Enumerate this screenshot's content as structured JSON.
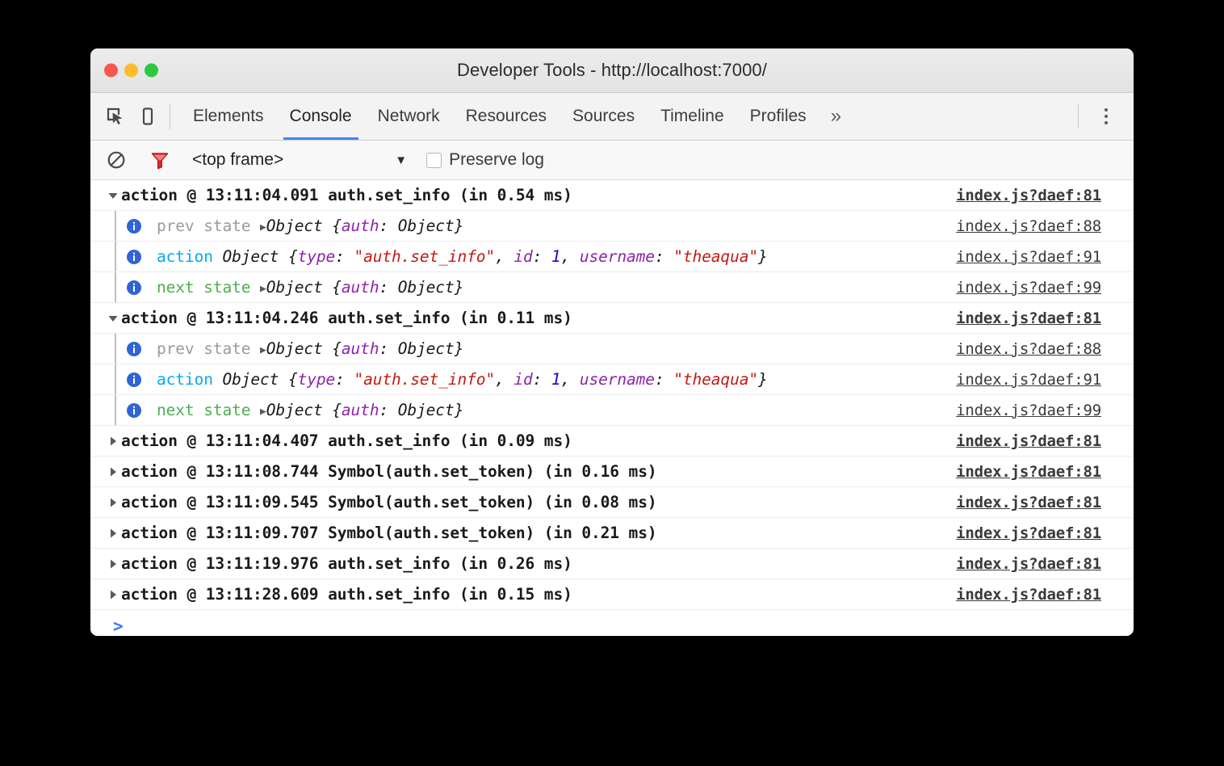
{
  "window": {
    "title": "Developer Tools - http://localhost:7000/",
    "traffic_lights": [
      {
        "name": "close",
        "color": "#f9564f"
      },
      {
        "name": "minimize",
        "color": "#fcbc2d"
      },
      {
        "name": "zoom",
        "color": "#2ec840"
      }
    ]
  },
  "tabbar": {
    "inspect_icon": "inspect-element-icon",
    "device_icon": "device-toolbar-icon",
    "tabs": [
      {
        "label": "Elements",
        "active": false
      },
      {
        "label": "Console",
        "active": true
      },
      {
        "label": "Network",
        "active": false
      },
      {
        "label": "Resources",
        "active": false
      },
      {
        "label": "Sources",
        "active": false
      },
      {
        "label": "Timeline",
        "active": false
      },
      {
        "label": "Profiles",
        "active": false
      }
    ],
    "more_label": "»",
    "menu_icon": "kebab-menu-icon",
    "active_underline_color": "#4285f4"
  },
  "filterbar": {
    "clear_icon": "clear-console-icon",
    "filter_icon": "filter-icon",
    "filter_active_color": "#d81f1f",
    "frame_selector": "<top frame>",
    "caret": "▼",
    "preserve_log_label": "Preserve log",
    "preserve_log_checked": false
  },
  "console": {
    "rows": [
      {
        "kind": "header",
        "expanded": true,
        "text": "action @ 13:11:04.091 auth.set_info (in 0.54 ms)",
        "source": "index.js?daef:81"
      },
      {
        "kind": "prev-state",
        "label": "prev state",
        "text": "Object {auth: Object}",
        "source": "index.js?daef:88"
      },
      {
        "kind": "action",
        "label": "action",
        "text": "Object {type: \"auth.set_info\", id: 1, username: \"theaqua\"}",
        "source": "index.js?daef:91"
      },
      {
        "kind": "next-state",
        "label": "next state",
        "text": "Object {auth: Object}",
        "source": "index.js?daef:99"
      },
      {
        "kind": "header",
        "expanded": true,
        "text": "action @ 13:11:04.246 auth.set_info (in 0.11 ms)",
        "source": "index.js?daef:81"
      },
      {
        "kind": "prev-state",
        "label": "prev state",
        "text": "Object {auth: Object}",
        "source": "index.js?daef:88"
      },
      {
        "kind": "action",
        "label": "action",
        "text": "Object {type: \"auth.set_info\", id: 1, username: \"theaqua\"}",
        "source": "index.js?daef:91"
      },
      {
        "kind": "next-state",
        "label": "next state",
        "text": "Object {auth: Object}",
        "source": "index.js?daef:99"
      },
      {
        "kind": "collapsed",
        "expanded": false,
        "text": "action @ 13:11:04.407 auth.set_info (in 0.09 ms)",
        "source": "index.js?daef:81"
      },
      {
        "kind": "collapsed",
        "expanded": false,
        "text": "action @ 13:11:08.744 Symbol(auth.set_token) (in 0.16 ms)",
        "source": "index.js?daef:81"
      },
      {
        "kind": "collapsed",
        "expanded": false,
        "text": "action @ 13:11:09.545 Symbol(auth.set_token) (in 0.08 ms)",
        "source": "index.js?daef:81"
      },
      {
        "kind": "collapsed",
        "expanded": false,
        "text": "action @ 13:11:09.707 Symbol(auth.set_token) (in 0.21 ms)",
        "source": "index.js?daef:81"
      },
      {
        "kind": "collapsed",
        "expanded": false,
        "text": "action @ 13:11:19.976 auth.set_info (in 0.26 ms)",
        "source": "index.js?daef:81"
      },
      {
        "kind": "collapsed",
        "expanded": false,
        "text": "action @ 13:11:28.609 auth.set_info (in 0.15 ms)",
        "source": "index.js?daef:81"
      }
    ],
    "prompt": ">",
    "prompt_value": "",
    "colors": {
      "prev_state_label": "#9b9b9b",
      "action_label": "#03a9f4",
      "next_state_label": "#4caf50",
      "object_key": "#8e24aa",
      "string_value": "#c41a16",
      "number_value": "#1c00cf"
    }
  }
}
